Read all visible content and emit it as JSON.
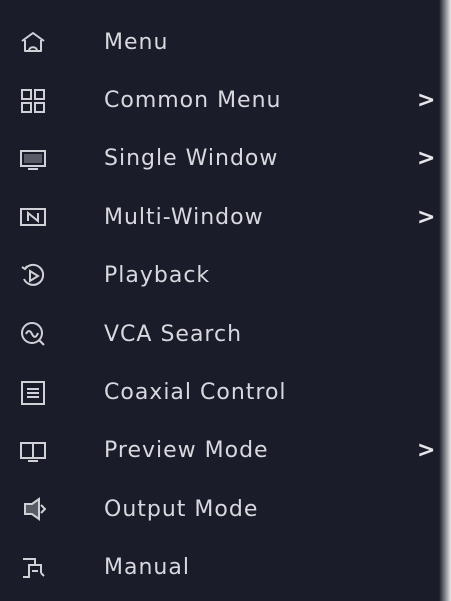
{
  "menu": {
    "items": [
      {
        "label": "Menu",
        "icon": "home-icon",
        "submenu": false
      },
      {
        "label": "Common Menu",
        "icon": "grid-icon",
        "submenu": true,
        "chevron": ">"
      },
      {
        "label": "Single Window",
        "icon": "single-window-icon",
        "submenu": true,
        "chevron": ">"
      },
      {
        "label": "Multi-Window",
        "icon": "multi-window-icon",
        "submenu": true,
        "chevron": ">"
      },
      {
        "label": "Playback",
        "icon": "playback-icon",
        "submenu": false
      },
      {
        "label": "VCA Search",
        "icon": "vca-search-icon",
        "submenu": false
      },
      {
        "label": "Coaxial Control",
        "icon": "coaxial-control-icon",
        "submenu": false
      },
      {
        "label": "Preview Mode",
        "icon": "preview-mode-icon",
        "submenu": true,
        "chevron": ">"
      },
      {
        "label": "Output Mode",
        "icon": "output-mode-icon",
        "submenu": false
      },
      {
        "label": "Manual",
        "icon": "manual-icon",
        "submenu": false
      }
    ]
  },
  "colors": {
    "background": "#1a1c29",
    "text": "#d8d9de",
    "icon": "#d0d1d6"
  }
}
